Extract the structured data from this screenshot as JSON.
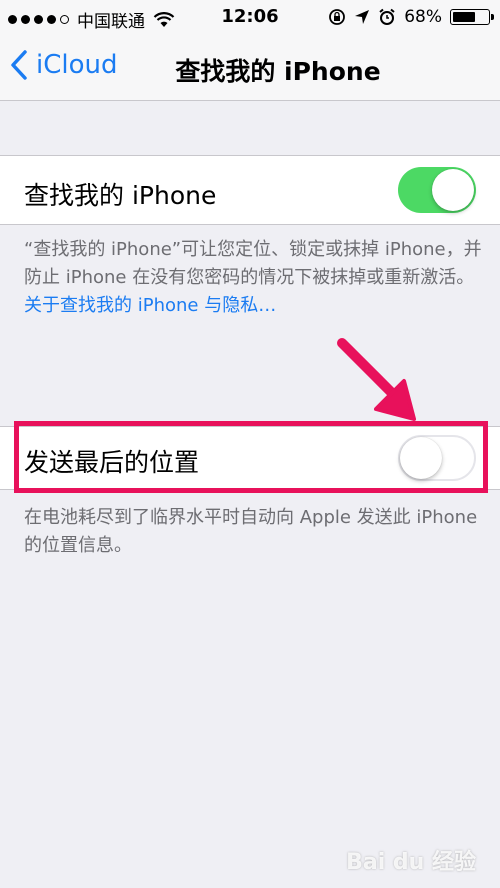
{
  "status_bar": {
    "carrier": "中国联通",
    "time": "12:06",
    "battery_percent": "68%",
    "battery_level": 0.68,
    "signal_dots_filled": 4,
    "signal_dots_total": 5
  },
  "nav": {
    "back_label": "iCloud",
    "title": "查找我的 iPhone"
  },
  "find_my_iphone": {
    "label": "查找我的 iPhone",
    "enabled": true,
    "footer_text": "“查找我的 iPhone”可让您定位、锁定或抹掉 iPhone，并防止 iPhone 在没有您密码的情况下被抹掉或重新激活。",
    "footer_link": "关于查找我的 iPhone 与隐私…"
  },
  "send_last_location": {
    "label": "发送最后的位置",
    "enabled": false,
    "footer_text": "在电池耗尽到了临界水平时自动向 Apple 发送此 iPhone 的位置信息。"
  },
  "colors": {
    "accent": "#1b7cf2",
    "toggle_on": "#4cd964",
    "annotation": "#e8115b",
    "background": "#efeff4"
  },
  "watermark": "Bai du 经验"
}
